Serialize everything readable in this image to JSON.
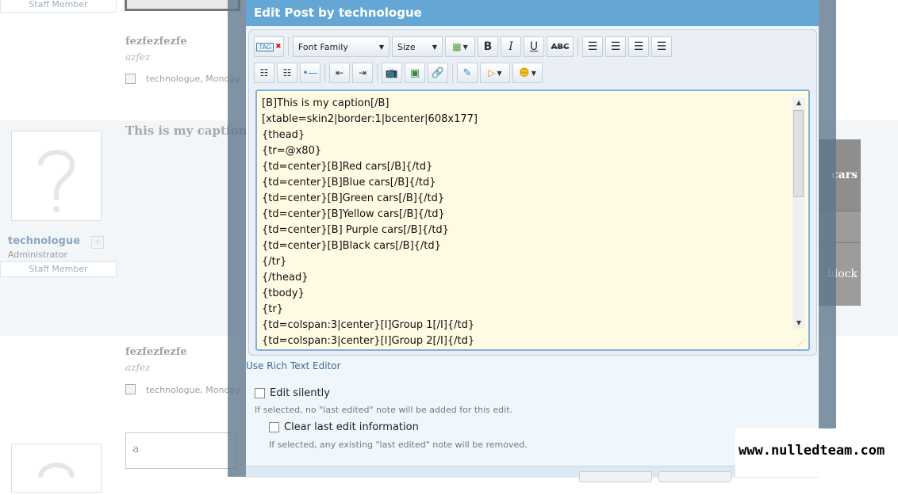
{
  "background": {
    "staff_label": "Staff Member",
    "posts": [
      {
        "name": "fezfezfezfe",
        "sub": "azfez",
        "line": "technologue, Monday"
      },
      {
        "name": "fezfezfezfe",
        "sub": "azfez",
        "line": "technologue, Monday"
      }
    ],
    "post_title": "This is my caption",
    "user": {
      "name": "technologue",
      "role": "Administrator"
    },
    "right_table": {
      "head": "cars",
      "cell": "block"
    },
    "reply_text": "a"
  },
  "modal": {
    "title": "Edit Post by technologue",
    "toolbar": {
      "tag_label": "TAG",
      "font_family": "Font Family",
      "size": "Size",
      "bold": "B",
      "italic": "I",
      "underline": "U",
      "strike": "ABC"
    },
    "code_lines": [
      "[B]This is my caption[/B]",
      "[xtable=skin2|border:1|bcenter|608x177]",
      "{thead}",
      "{tr=@x80}",
      "{td=center}[B]Red cars[/B]{/td}",
      "{td=center}[B]Blue cars[/B]{/td}",
      "{td=center}[B]Green cars[/B]{/td}",
      "{td=center}[B]Yellow cars[/B]{/td}",
      "{td=center}[B] Purple cars[/B]{/td}",
      "{td=center}[B]Black cars[/B]{/td}",
      "{/tr}",
      "{/thead}",
      "{tbody}",
      "{tr}",
      "{td=colspan:3|center}[I]Group 1[/I]{/td}",
      "{td=colspan:3|center}[I]Group 2[/I]{/td}"
    ],
    "rich_text_link": "Use Rich Text Editor",
    "edit_silently": {
      "label": "Edit silently",
      "note": "If selected, no \"last edited\" note will be added for this edit."
    },
    "clear_last": {
      "label": "Clear last edit information",
      "note": "If selected, any existing \"last edited\" note will be removed."
    }
  },
  "watermark": "www.nulledteam.com"
}
